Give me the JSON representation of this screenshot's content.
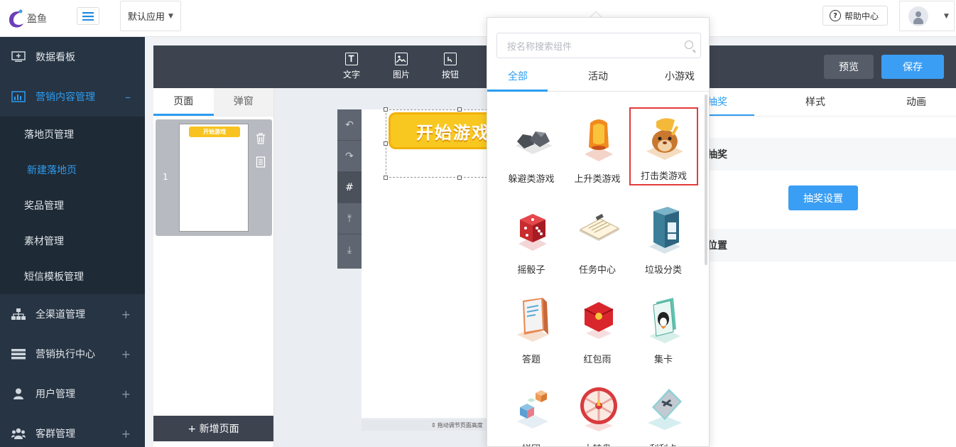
{
  "header": {
    "logo_text": "盈鱼",
    "app_select": "默认应用",
    "help": "帮助中心"
  },
  "sidebar": {
    "items": [
      {
        "label": "数据看板",
        "icon": "monitor-icon"
      },
      {
        "label": "营销内容管理",
        "icon": "bar-chart-icon",
        "toggle": "–"
      },
      {
        "label": "全渠道管理",
        "icon": "org-chart-icon",
        "toggle": "+"
      },
      {
        "label": "营销执行中心",
        "icon": "server-icon",
        "toggle": "+"
      },
      {
        "label": "用户管理",
        "icon": "user-icon",
        "toggle": "+"
      },
      {
        "label": "客群管理",
        "icon": "group-icon",
        "toggle": "+"
      }
    ],
    "sub_items": [
      "落地页管理",
      "新建落地页",
      "奖品管理",
      "素材管理",
      "短信模板管理"
    ]
  },
  "toolbar": {
    "tools": [
      {
        "label": "文字",
        "icon": "text-icon"
      },
      {
        "label": "图片",
        "icon": "image-icon"
      },
      {
        "label": "按钮",
        "icon": "button-icon"
      }
    ],
    "preview": "预览",
    "save": "保存"
  },
  "page_panel": {
    "tabs": [
      "页面",
      "弹窗"
    ],
    "page_number": "1",
    "mini_button": "开始游戏",
    "add_page": "+ 新增页面"
  },
  "canvas": {
    "start_button": "开始游戏",
    "drag_hint": "拖动调节页面高度"
  },
  "right_panel": {
    "tabs": [
      "抽奖",
      "样式",
      "动画"
    ],
    "section_lottery": "抽奖",
    "lottery_button": "抽奖设置",
    "section_position": "位置"
  },
  "popover": {
    "search_placeholder": "按名称搜索组件",
    "tabs": [
      "全部",
      "活动",
      "小游戏"
    ],
    "items": [
      {
        "label": "躲避类游戏",
        "icon": "rocks-icon"
      },
      {
        "label": "上升类游戏",
        "icon": "lantern-icon"
      },
      {
        "label": "打击类游戏",
        "icon": "hamster-icon"
      },
      {
        "label": "摇骰子",
        "icon": "dice-icon"
      },
      {
        "label": "任务中心",
        "icon": "clipboard-icon"
      },
      {
        "label": "垃圾分类",
        "icon": "trash-bin-icon"
      },
      {
        "label": "答题",
        "icon": "book-icon"
      },
      {
        "label": "红包雨",
        "icon": "red-envelope-icon"
      },
      {
        "label": "集卡",
        "icon": "card-icon"
      },
      {
        "label": "拼团",
        "icon": "cubes-icon"
      },
      {
        "label": "大转盘",
        "icon": "wheel-icon"
      },
      {
        "label": "刮刮卡",
        "icon": "scratch-card-icon"
      }
    ]
  },
  "colors": {
    "accent": "#2d9cf0",
    "sidebar_bg": "#273443",
    "toolbar_bg": "#3d4450",
    "highlight_border": "#e33b3b"
  }
}
